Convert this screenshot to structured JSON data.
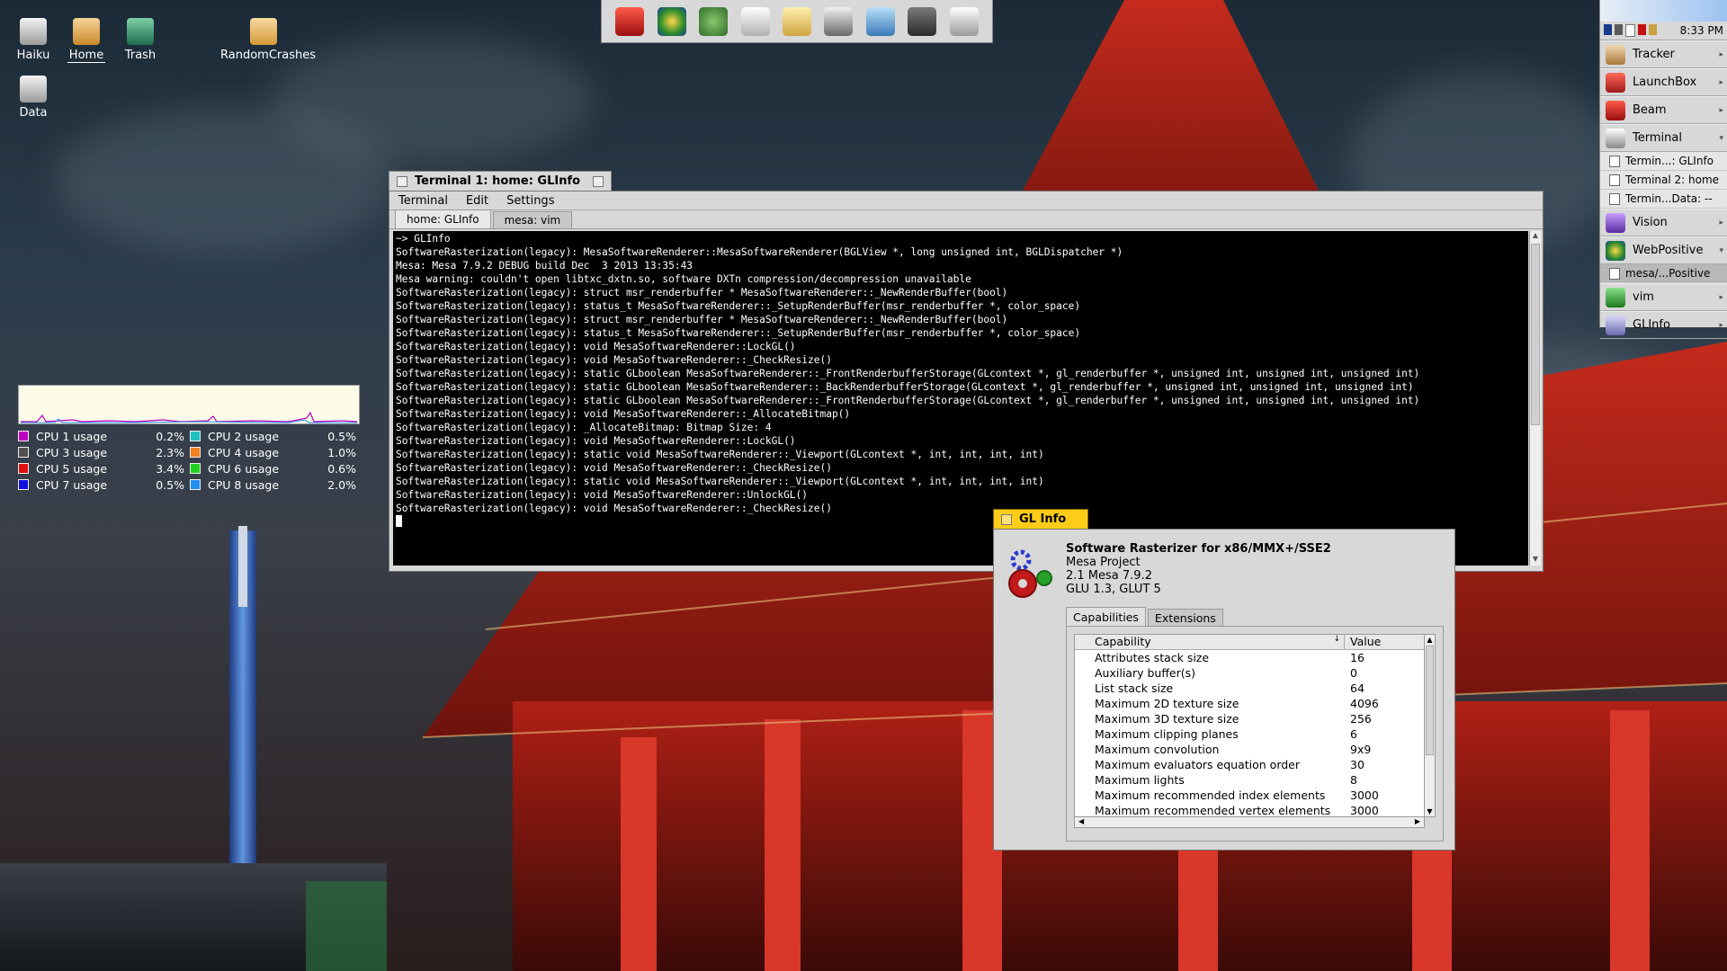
{
  "desktop_icons": [
    {
      "label": "Haiku",
      "icon": "haiku-disk-icon"
    },
    {
      "label": "Home",
      "icon": "home-folder-icon"
    },
    {
      "label": "Trash",
      "icon": "trash-icon"
    },
    {
      "label": "RandomCrashes",
      "icon": "folder-icon"
    },
    {
      "label": "Data",
      "icon": "disk-icon"
    }
  ],
  "toolbar_icons": [
    "beam-app-icon",
    "webpositive-icon",
    "tree-app-icon",
    "file-icon",
    "writer-icon",
    "printer-icon",
    "book-icon",
    "disk-icon",
    "drive-icon"
  ],
  "deskbar": {
    "time": "8:33 PM",
    "items": [
      {
        "label": "Tracker"
      },
      {
        "label": "LaunchBox"
      },
      {
        "label": "Beam"
      },
      {
        "label": "Terminal"
      }
    ],
    "terminal_windows": [
      "Termin...: GLInfo",
      "Terminal 2: home",
      "Termin...Data: --"
    ],
    "items2": [
      {
        "label": "Vision"
      },
      {
        "label": "WebPositive"
      }
    ],
    "webpositive_windows": [
      "mesa/...Positive"
    ],
    "items3": [
      {
        "label": "vim"
      },
      {
        "label": "GLInfo"
      }
    ]
  },
  "cpu_monitor": {
    "cpus": [
      {
        "name": "CPU 1 usage",
        "value": "0.2%",
        "color": "#c000c0"
      },
      {
        "name": "CPU 2 usage",
        "value": "0.5%",
        "color": "#20c0c0"
      },
      {
        "name": "CPU 3 usage",
        "value": "2.3%",
        "color": "#505050"
      },
      {
        "name": "CPU 4 usage",
        "value": "1.0%",
        "color": "#f08020"
      },
      {
        "name": "CPU 5 usage",
        "value": "3.4%",
        "color": "#e01010"
      },
      {
        "name": "CPU 6 usage",
        "value": "0.6%",
        "color": "#20d020"
      },
      {
        "name": "CPU 7 usage",
        "value": "0.5%",
        "color": "#1010e0"
      },
      {
        "name": "CPU 8 usage",
        "value": "2.0%",
        "color": "#2090f0"
      }
    ]
  },
  "terminal": {
    "title": "Terminal 1: home: GLInfo",
    "menu": [
      "Terminal",
      "Edit",
      "Settings"
    ],
    "tabs": [
      "home: GLInfo",
      "mesa: vim"
    ],
    "lines": [
      "~> GLInfo",
      "SoftwareRasterization(legacy): MesaSoftwareRenderer::MesaSoftwareRenderer(BGLView *, long unsigned int, BGLDispatcher *)",
      "Mesa: Mesa 7.9.2 DEBUG build Dec  3 2013 13:35:43",
      "Mesa warning: couldn't open libtxc_dxtn.so, software DXTn compression/decompression unavailable",
      "SoftwareRasterization(legacy): struct msr_renderbuffer * MesaSoftwareRenderer::_NewRenderBuffer(bool)",
      "SoftwareRasterization(legacy): status_t MesaSoftwareRenderer::_SetupRenderBuffer(msr_renderbuffer *, color_space)",
      "SoftwareRasterization(legacy): struct msr_renderbuffer * MesaSoftwareRenderer::_NewRenderBuffer(bool)",
      "SoftwareRasterization(legacy): status_t MesaSoftwareRenderer::_SetupRenderBuffer(msr_renderbuffer *, color_space)",
      "SoftwareRasterization(legacy): void MesaSoftwareRenderer::LockGL()",
      "SoftwareRasterization(legacy): void MesaSoftwareRenderer::_CheckResize()",
      "SoftwareRasterization(legacy): static GLboolean MesaSoftwareRenderer::_FrontRenderbufferStorage(GLcontext *, gl_renderbuffer *, unsigned int, unsigned int, unsigned int)",
      "SoftwareRasterization(legacy): static GLboolean MesaSoftwareRenderer::_BackRenderbufferStorage(GLcontext *, gl_renderbuffer *, unsigned int, unsigned int, unsigned int)",
      "SoftwareRasterization(legacy): static GLboolean MesaSoftwareRenderer::_FrontRenderbufferStorage(GLcontext *, gl_renderbuffer *, unsigned int, unsigned int, unsigned int)",
      "SoftwareRasterization(legacy): void MesaSoftwareRenderer::_AllocateBitmap()",
      "SoftwareRasterization(legacy): _AllocateBitmap: Bitmap Size: 4",
      "SoftwareRasterization(legacy): void MesaSoftwareRenderer::LockGL()",
      "SoftwareRasterization(legacy): static void MesaSoftwareRenderer::_Viewport(GLcontext *, int, int, int, int)",
      "SoftwareRasterization(legacy): void MesaSoftwareRenderer::_CheckResize()",
      "SoftwareRasterization(legacy): static void MesaSoftwareRenderer::_Viewport(GLcontext *, int, int, int, int)",
      "SoftwareRasterization(legacy): void MesaSoftwareRenderer::UnlockGL()",
      "SoftwareRasterization(legacy): void MesaSoftwareRenderer::_CheckResize()"
    ]
  },
  "glinfo": {
    "title": "GL Info",
    "renderer": "Software Rasterizer for x86/MMX+/SSE2",
    "vendor": "Mesa Project",
    "version": "2.1 Mesa 7.9.2",
    "glu": "GLU 1.3, GLUT 5",
    "tabs": [
      "Capabilities",
      "Extensions"
    ],
    "columns": [
      "Capability",
      "Value"
    ],
    "rows": [
      [
        "Attributes stack size",
        "16"
      ],
      [
        "Auxiliary buffer(s)",
        "0"
      ],
      [
        "List stack size",
        "64"
      ],
      [
        "Maximum 2D texture size",
        "4096"
      ],
      [
        "Maximum 3D texture size",
        "256"
      ],
      [
        "Maximum clipping planes",
        "6"
      ],
      [
        "Maximum convolution",
        "9x9"
      ],
      [
        "Maximum evaluators equation order",
        "30"
      ],
      [
        "Maximum lights",
        "8"
      ],
      [
        "Maximum recommended index elements",
        "3000"
      ],
      [
        "Maximum recommended vertex elements",
        "3000"
      ]
    ]
  }
}
